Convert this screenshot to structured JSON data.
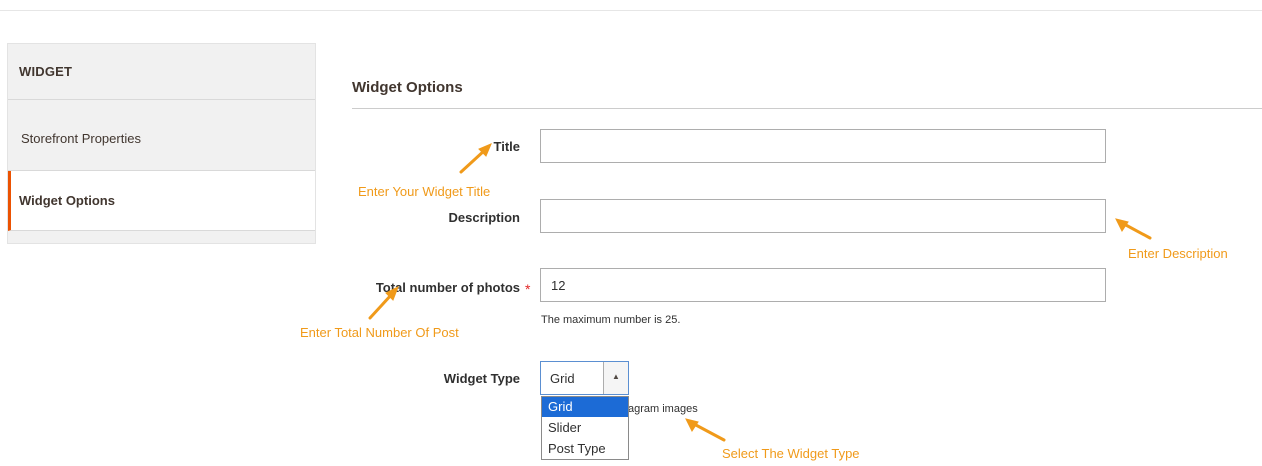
{
  "sidebar": {
    "heading": "WIDGET",
    "items": [
      {
        "label": "Storefront Properties",
        "active": false
      },
      {
        "label": "Widget Options",
        "active": true
      }
    ]
  },
  "section": {
    "title": "Widget Options"
  },
  "fields": {
    "title": {
      "label": "Title",
      "value": ""
    },
    "description": {
      "label": "Description",
      "value": ""
    },
    "total_photos": {
      "label": "Total number of photos",
      "required_mark": "*",
      "value": "12",
      "note": "The maximum number is 25."
    },
    "widget_type": {
      "label": "Widget Type",
      "selected": "Grid",
      "arrow": "▲",
      "options": [
        "Grid",
        "Slider",
        "Post Type"
      ],
      "note_partial": "agram images"
    }
  },
  "annotations": {
    "title": "Enter Your Widget Title",
    "description": "Enter Description",
    "total": "Enter Total Number Of Post",
    "type": "Select The Widget Type"
  },
  "colors": {
    "accent": "#eb5202",
    "annotation": "#f09a1a",
    "selected_option": "#1c6bd6",
    "required": "#e22626"
  }
}
